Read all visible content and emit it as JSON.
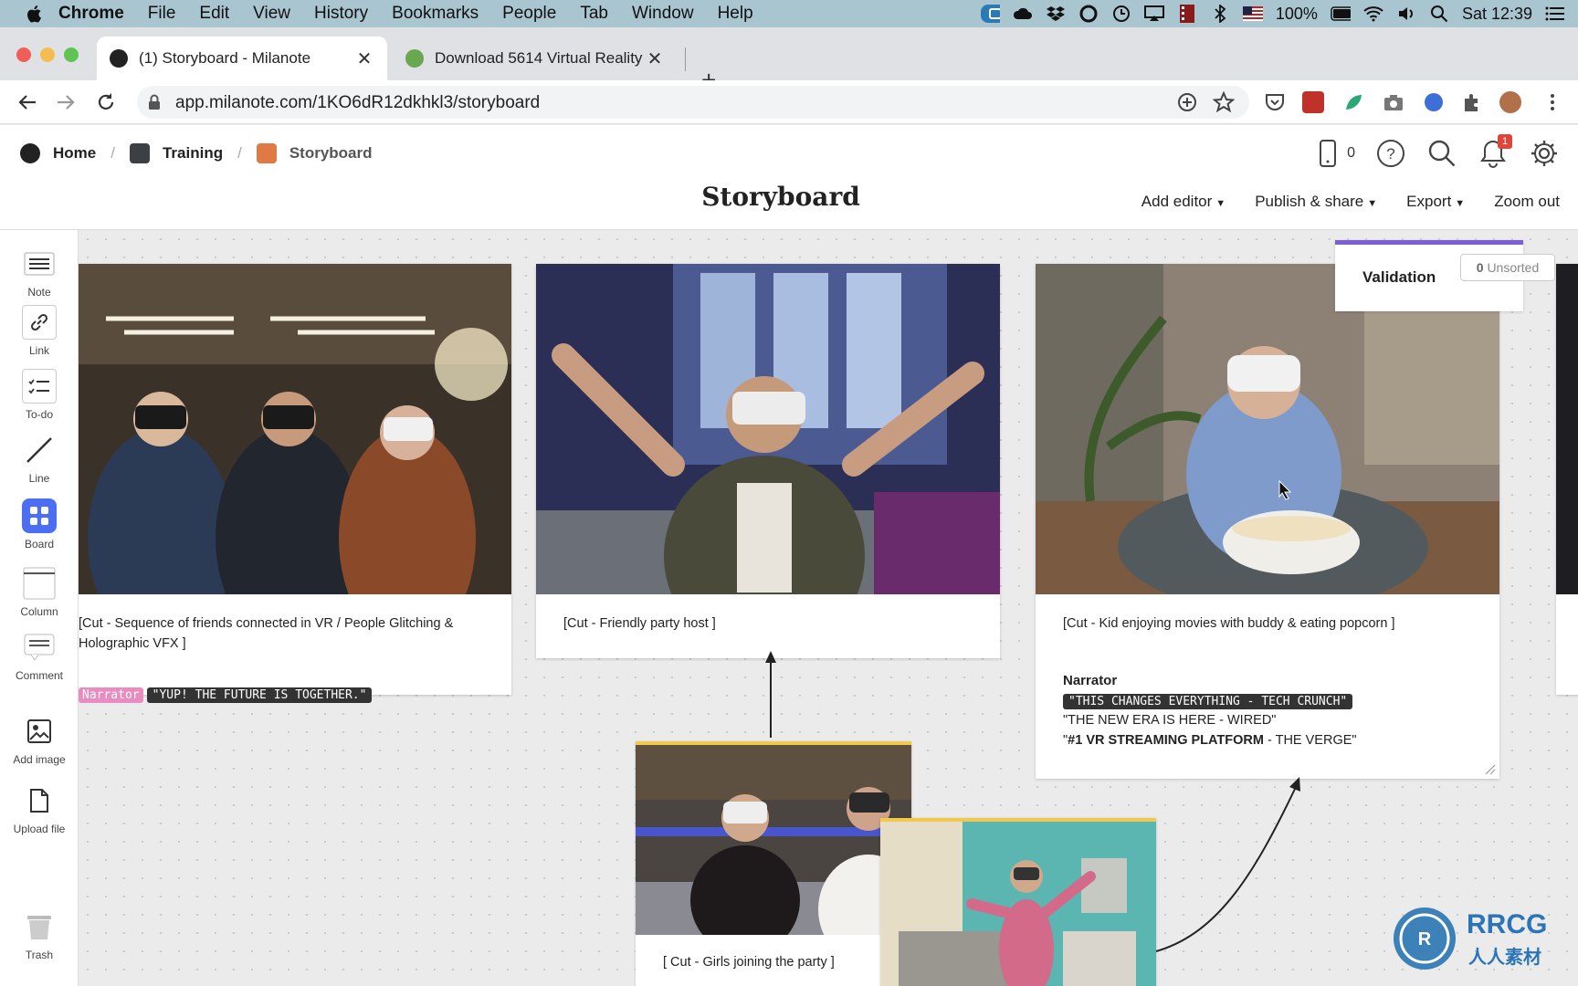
{
  "menubar": {
    "app": "Chrome",
    "items": [
      "File",
      "Edit",
      "View",
      "History",
      "Bookmarks",
      "People",
      "Tab",
      "Window",
      "Help"
    ],
    "battery": "100%",
    "clock": "Sat 12:39"
  },
  "tabs": [
    {
      "title": "(1) Storyboard - Milanote",
      "active": true
    },
    {
      "title": "Download 5614 Virtual Reality",
      "active": false
    }
  ],
  "address_bar": {
    "url": "app.milanote.com/1KO6dR12dkhkl3/storyboard"
  },
  "breadcrumb": {
    "home": "Home",
    "parent": "Training",
    "current": "Storyboard"
  },
  "board": {
    "title": "Storyboard"
  },
  "header": {
    "device_count": "0",
    "notification_count": "1",
    "actions": {
      "add_editor": "Add editor",
      "publish_share": "Publish & share",
      "export": "Export",
      "zoom_out": "Zoom out"
    }
  },
  "tools": [
    {
      "label": "Note",
      "icon": "note-icon"
    },
    {
      "label": "Link",
      "icon": "link-icon"
    },
    {
      "label": "To-do",
      "icon": "todo-icon"
    },
    {
      "label": "Line",
      "icon": "line-icon"
    },
    {
      "label": "Board",
      "icon": "board-icon"
    },
    {
      "label": "Column",
      "icon": "column-icon"
    },
    {
      "label": "Comment",
      "icon": "comment-icon"
    },
    {
      "label": "Add image",
      "icon": "image-icon"
    },
    {
      "label": "Upload file",
      "icon": "file-icon"
    },
    {
      "label": "Trash",
      "icon": "trash-icon"
    }
  ],
  "cards": {
    "c1": {
      "caption": "[Cut - Sequence of friends connected in VR / People Glitching & Holographic VFX ]",
      "narrator_tag": "Narrator",
      "quote": "\"YUP! THE FUTURE IS TOGETHER.\""
    },
    "c2": {
      "caption": "[Cut - Friendly party host ]"
    },
    "c3": {
      "caption": "[Cut - Kid enjoying movies with buddy & eating popcorn ]",
      "narrator": "Narrator",
      "q1": "\"THIS CHANGES EVERYTHING - TECH CRUNCH\"",
      "q2": "\"THE NEW ERA IS HERE - WIRED\"",
      "q3_open": "\"",
      "q3_bold": "#1 VR STREAMING PLATFORM",
      "q3_rest": " - THE VERGE\""
    },
    "c4": {
      "caption": "[ Cut - Girls joining the party ]"
    }
  },
  "validation": {
    "title": "Validation",
    "unsorted_count": "0",
    "unsorted_label": "Unsorted"
  },
  "watermark": {
    "brand": "RRCG",
    "subtitle": "人人素材"
  }
}
